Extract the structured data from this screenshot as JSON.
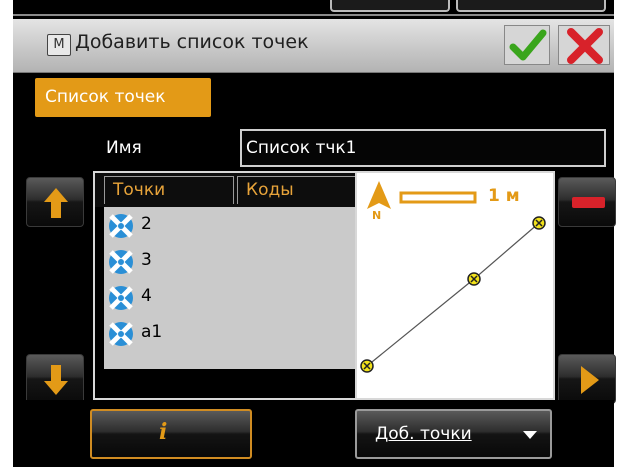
{
  "window": {
    "title": "Добавить список точек",
    "app_icon": "M",
    "ok_icon": "checkmark-icon",
    "cancel_icon": "close-icon"
  },
  "tabs": [
    {
      "label": "Список точек",
      "active": true
    }
  ],
  "form": {
    "name_label": "Имя",
    "name_value": "Список тчк1"
  },
  "list": {
    "columns": [
      "Точки",
      "Коды"
    ],
    "rows": [
      {
        "point": "2",
        "code": ""
      },
      {
        "point": "3",
        "code": ""
      },
      {
        "point": "4",
        "code": ""
      },
      {
        "point": "a1",
        "code": ""
      }
    ]
  },
  "map": {
    "north_label": "N",
    "scale_label": "1 м"
  },
  "buttons": {
    "info_label": "i",
    "add_points_label": "Доб. точки"
  },
  "colors": {
    "accent": "#e39a17",
    "ok": "#3aa51c",
    "cancel": "#d8222a",
    "point_icon": "#2a8fd6"
  }
}
